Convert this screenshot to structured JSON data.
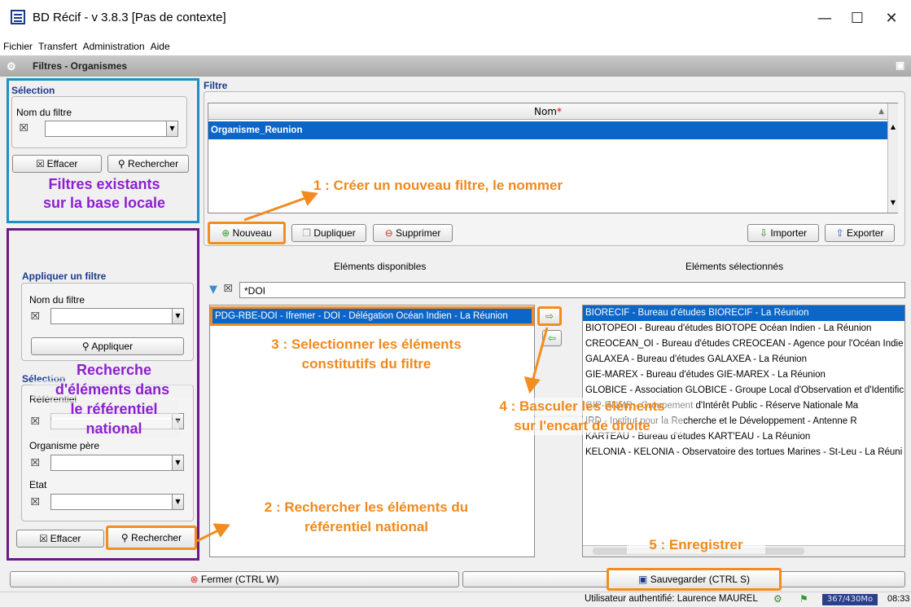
{
  "window": {
    "title": "BD Récif - v 3.8.3 [Pas de contexte]",
    "minimize": "—",
    "maximize": "☐",
    "close": "✕"
  },
  "menu": [
    "Fichier",
    "Transfert",
    "Administration",
    "Aide"
  ],
  "tab_title": "Filtres - Organismes",
  "selection": {
    "section": "Sélection",
    "filter_name_label": "Nom du filtre",
    "clear_label": "Effacer",
    "search_label": "Rechercher"
  },
  "apply": {
    "section": "Appliquer un filtre",
    "filter_name_label": "Nom du filtre",
    "apply_label": "Appliquer",
    "section2": "Sélection",
    "ref_label": "Référentiel",
    "parent_label": "Organisme père",
    "state_label": "Etat",
    "clear_label": "Effacer",
    "search_label": "Rechercher"
  },
  "filter": {
    "section": "Filtre",
    "column_header": "Nom",
    "required_mark": "*",
    "rows": [
      "Organisme_Reunion"
    ],
    "new_label": "Nouveau",
    "duplicate_label": "Dupliquer",
    "delete_label": "Supprimer",
    "import_label": "Importer",
    "export_label": "Exporter"
  },
  "available": {
    "header": "Eléments disponibles",
    "search_value": "*DOI",
    "items": [
      "PDG-RBE-DOI - Ifremer - DOI - Délégation Océan Indien - La Réunion"
    ]
  },
  "selected": {
    "header": "Eléments sélectionnés",
    "items": [
      "BIORECIF - Bureau d'études BIORECIF - La Réunion",
      "BIOTOPEOI - Bureau d'études BIOTOPE Océan Indien - La Réunion",
      "CREOCEAN_OI - Bureau d'études CREOCEAN - Agence pour l'Océan Indie",
      "GALAXEA - Bureau d'études GALAXEA - La Réunion",
      "GIE-MAREX - Bureau d'études GIE-MAREX - La Réunion",
      "GLOBICE - Association GLOBICE - Groupe Local d'Observation et d'Identific",
      "GIP-RNMR - Groupement d'Intérêt Public - Réserve Nationale Ma",
      "IRD - Institut pour la Recherche et le Développement - Antenne R",
      "KARTEAU - Bureau d'études KART'EAU - La Réunion",
      "KELONIA - KELONIA - Observatoire des tortues Marines - St-Leu - La Réuni"
    ]
  },
  "bottom": {
    "close_label": "Fermer (CTRL W)",
    "save_label": "Sauvegarder (CTRL S)"
  },
  "status": {
    "user": "Utilisateur authentifié: Laurence MAUREL",
    "memory": "367/430Mo",
    "time": "08:33"
  },
  "annotations": {
    "a1": "1 : Créer un nouveau filtre, le nommer",
    "a2_line1": "2 : Rechercher les éléments du",
    "a2_line2": "référentiel national",
    "a3_line1": "3 : Selectionner les éléments",
    "a3_line2": "constitutifs du filtre",
    "a4_line1": "4 : Basculer les éléments",
    "a4_line2": "sur l'encart de droite",
    "a5": "5 : Enregistrer",
    "p1_line1": "Filtres existants",
    "p1_line2": "sur la base locale",
    "p2_line1": "Recherche",
    "p2_line2": "d'éléments dans",
    "p2_line3": "le référentiel",
    "p2_line4": "national"
  },
  "colors": {
    "accent_orange": "#f28c1e",
    "purple_text": "#8b1fd0",
    "purple_border": "#6a1a86",
    "blue_border": "#1f8fc1",
    "selection_blue": "#0c66c7"
  }
}
